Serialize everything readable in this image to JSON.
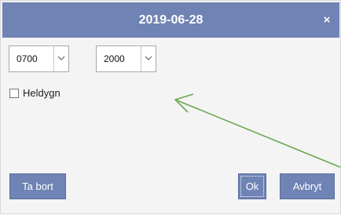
{
  "dialog": {
    "title": "2019-06-28",
    "close_glyph": "×"
  },
  "time_start": {
    "value": "0700"
  },
  "time_end": {
    "value": "2000"
  },
  "all_day": {
    "label": "Heldygn",
    "checked": false
  },
  "buttons": {
    "delete_label": "Ta bort",
    "ok_label": "Ok",
    "cancel_label": "Avbryt"
  },
  "colors": {
    "accent": "#6f83b4",
    "annotation_arrow": "#6aa84f"
  },
  "icons": {
    "close": "close-icon",
    "dropdown": "chevron-down-icon",
    "annotation": "annotation-arrow-icon"
  }
}
